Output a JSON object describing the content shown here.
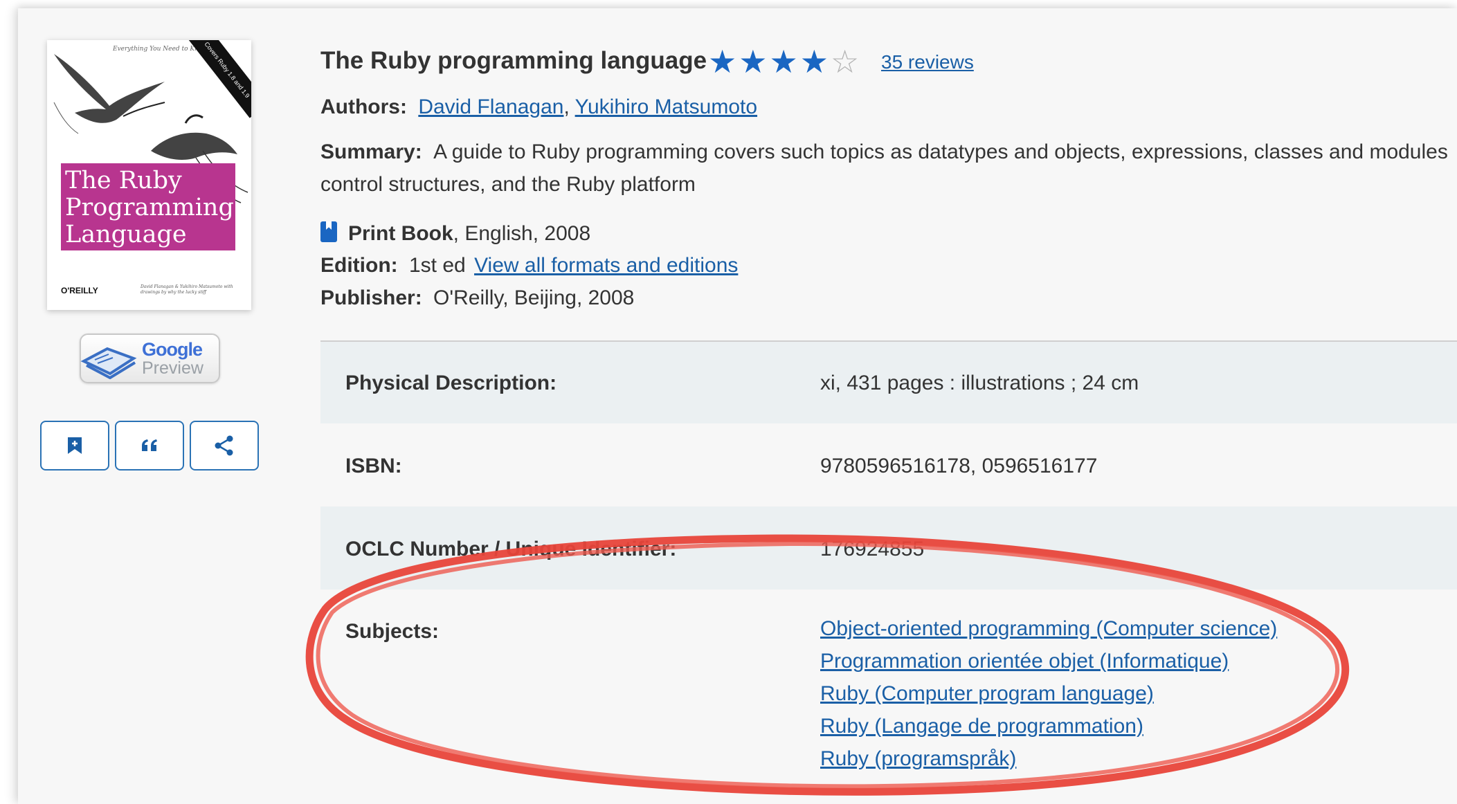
{
  "book": {
    "title": "The Ruby programming language",
    "rating": 4,
    "max_rating": 5,
    "reviews_label": "35 reviews",
    "authors_label": "Authors:",
    "authors": [
      "David Flanagan",
      "Yukihiro Matsumoto"
    ],
    "author_separator": ",",
    "summary_label": "Summary:",
    "summary_line1": "A guide to Ruby programming covers such topics as datatypes and objects, expressions, classes and modules",
    "summary_line2": "control structures, and the Ruby platform",
    "format_icon": "book-icon",
    "format_name": "Print Book",
    "format_details": ", English, 2008",
    "edition_label": "Edition:",
    "edition_value": "1st ed",
    "edition_link": "View all formats and editions",
    "publisher_label": "Publisher:",
    "publisher_value": "O'Reilly, Beijing, 2008"
  },
  "cover": {
    "tagline": "Everything You Need to Know",
    "badge": "Covers Ruby 1.8 and 1.9",
    "title_line1": "The Ruby",
    "title_line2": "Programming",
    "title_line3": "Language",
    "publisher": "O'REILLY",
    "authors_line": "David Flanagan & Yukihiro Matsumoto with drawings by why the lucky stiff"
  },
  "google_preview": {
    "word1": "Google",
    "word2": "Preview"
  },
  "actions": [
    {
      "name": "save-button",
      "icon": "bookmark-plus-icon"
    },
    {
      "name": "cite-button",
      "icon": "quote-icon"
    },
    {
      "name": "share-button",
      "icon": "share-icon"
    }
  ],
  "details": {
    "physical_label": "Physical Description:",
    "physical_value": "xi, 431 pages : illustrations ; 24 cm",
    "isbn_label": "ISBN:",
    "isbn_value": "9780596516178, 0596516177",
    "oclc_label": "OCLC Number / Unique Identifier:",
    "oclc_value": "176924855",
    "subjects_label": "Subjects:",
    "subjects": [
      "Object-oriented programming (Computer science)",
      "Programmation orientée objet (Informatique)",
      "Ruby (Computer program language)",
      "Ruby (Langage de programmation)",
      "Ruby (programspråk)"
    ]
  },
  "colors": {
    "link": "#1a5fa6",
    "star": "#1a66c2",
    "cover_title_block": "#b8358f",
    "annotation": "#e8443a",
    "row_shade": "#ebf0f2"
  }
}
